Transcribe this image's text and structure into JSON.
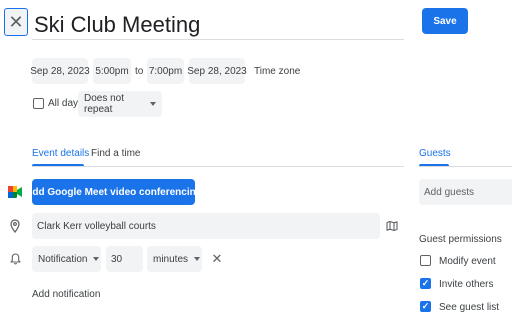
{
  "header": {
    "close_icon": "close-icon",
    "title": "Ski Club Meeting",
    "save_label": "Save"
  },
  "datetime": {
    "start_date": "Sep 28, 2023",
    "start_time": "5:00pm",
    "separator": "to",
    "end_time": "7:00pm",
    "end_date": "Sep 28, 2023",
    "time_zone_label": "Time zone"
  },
  "options": {
    "all_day_label": "All day",
    "all_day_checked": false,
    "repeat_value": "Does not repeat"
  },
  "tabs": [
    {
      "label": "Event details",
      "active": true
    },
    {
      "label": "Find a time",
      "active": false
    }
  ],
  "details": {
    "meet_button_label": "Add Google Meet video conferencing",
    "meet_icon": "google-meet-icon",
    "location_icon": "location-pin-icon",
    "location_value": "Clark Kerr volleyball courts",
    "map_icon": "map-icon",
    "notification_icon": "bell-icon",
    "notification_type": "Notification",
    "notification_amount": "30",
    "notification_unit": "minutes",
    "remove_notification_icon": "close-icon",
    "add_notification_label": "Add notification"
  },
  "guests": {
    "tab_label": "Guests",
    "add_guests_placeholder": "Add guests",
    "permissions_title": "Guest permissions",
    "permissions": [
      {
        "label": "Modify event",
        "checked": false
      },
      {
        "label": "Invite others",
        "checked": true
      },
      {
        "label": "See guest list",
        "checked": true
      }
    ]
  },
  "colors": {
    "accent": "#1a73e8",
    "chip_background": "#f1f3f4",
    "text": "#3c4043"
  }
}
